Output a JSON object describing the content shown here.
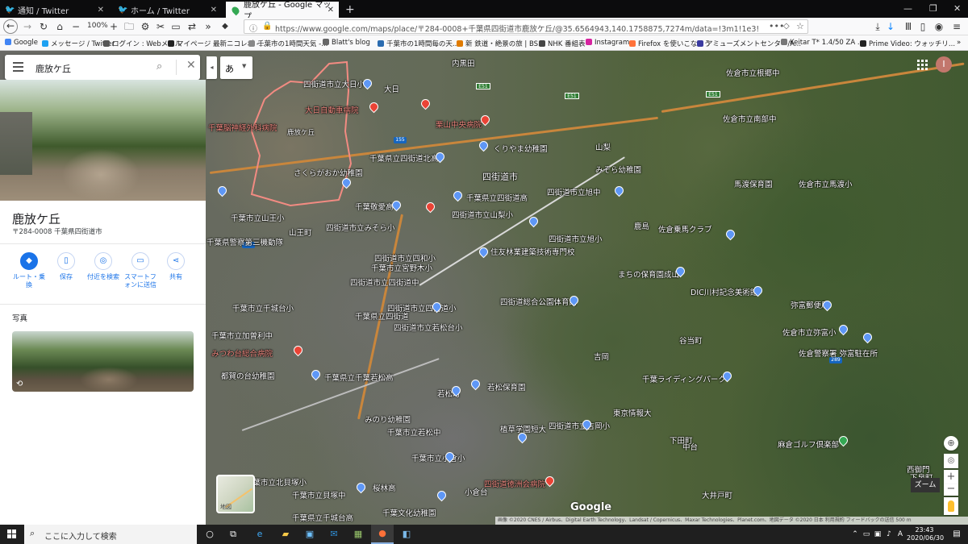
{
  "browser": {
    "tabs": [
      {
        "title": "通知 / Twitter",
        "icon": "twitter-icon"
      },
      {
        "title": "ホーム / Twitter",
        "icon": "twitter-icon"
      },
      {
        "title": "鹿放ケ丘 - Google マップ",
        "icon": "google-maps-icon",
        "active": true
      }
    ],
    "zoom": "100%",
    "url": "https://www.google.com/maps/place/〒284-0008+千葉県四街道市鹿放ケ丘/@35.6564943,140.1758875,7274m/data=!3m1!1e3!4m5!3m4!1s0x602285ccf8840e",
    "bookmarks": [
      "Google",
      "メッセージ / Twitter",
      "ログイン : Webメール",
      "マイページ 最新ニコレポ -...",
      "千葉市の1時間天気 -...",
      "Blatt's blog",
      "千葉市の1時間毎の天...",
      "新 鉄道・絶景の旅 | BS...",
      "NHK 番組表",
      "Instagram",
      "Firefox を使いこなそう",
      "アミューズメントセンター/A...",
      "Keitar T* 1.4/50 ZA ...",
      "Prime Video: ウォッチリ..."
    ]
  },
  "maps": {
    "search_value": "鹿放ケ丘",
    "ime_label": "あ",
    "place": {
      "title": "鹿放ケ丘",
      "address": "〒284-0008 千葉県四街道市"
    },
    "actions": [
      {
        "label": "ルート・乗換",
        "icon": "directions-icon"
      },
      {
        "label": "保存",
        "icon": "bookmark-icon"
      },
      {
        "label": "付近を検索",
        "icon": "nearby-icon"
      },
      {
        "label": "スマートフォンに送信",
        "icon": "send-to-phone-icon"
      },
      {
        "label": "共有",
        "icon": "share-icon"
      }
    ],
    "photos_heading": "写真",
    "avatar_letter": "I",
    "zoom_label": "ズーム",
    "layer_label": "地図",
    "google_logo": "Google",
    "attribution": "画像 ©2020 CNES / Airbus、Digital Earth Technology、Landsat / Copernicus、Maxar Technologies、Planet.com、地図データ ©2020    日本    利用規約    フィードバックの送信    500 m",
    "labels": [
      "内黒田",
      "四街道市立大日小",
      "大日",
      "大日自動車病院",
      "千葉脳神経外科病院",
      "鹿放ケ丘",
      "栗山中央病院",
      "くりやま幼稚園",
      "千葉県立四街道北高",
      "さくらがおか幼稚園",
      "大日家屋通り",
      "四街道市",
      "千葉県立四街道高",
      "千葉敬愛高",
      "四街道市立旭中",
      "四街道市立みそら小",
      "四街道市立中央小",
      "四街道市立四和小",
      "千葉市立山王小",
      "千葉県警察第三機動隊",
      "山王町",
      "四街道市立山梨小",
      "四街道市立旭小",
      "住友林業建築技術専門校",
      "千葉市立宮野木小",
      "四街道市立四和小",
      "四街道市立四街道中",
      "みそら幼稚園",
      "千葉県立四街道高",
      "まちの保育園成山",
      "佐倉乗馬クラブ",
      "DIC川村記念美術館",
      "四街道市立四街道小",
      "千葉市立千城台小",
      "千葉県立四街道",
      "四街道市立若松台小",
      "四街道総合公園体育館",
      "佐倉市立南部中",
      "佐倉市立根郷中",
      "馬渡保育園",
      "佐倉市立馬渡小",
      "弥富郵便局",
      "佐倉市立弥富小",
      "佐倉警察署 弥富駐在所",
      "千葉ライディングパーク",
      "東京情報大",
      "四街道市立吉岡小",
      "下田町",
      "麻倉ゴルフ倶楽部",
      "千葉市立加曽利中",
      "みつわ台総合病院",
      "都賀の台幼稚園",
      "千葉県立千葉若松高",
      "若松町",
      "若松保育園",
      "みのり幼稚園",
      "千葉市立若松中",
      "植草学園短大",
      "千葉市立小倉小",
      "千葉市立北貝塚小",
      "四街道徳洲会病院",
      "桜林高",
      "小倉台",
      "千葉市立貝塚中",
      "千葉文化幼稚園",
      "千葉県立千城台高",
      "下泉町",
      "大井戸町",
      "西御門",
      "宮田",
      "佐倉市立王子台小",
      "佐倉市立さくら台",
      "佐倉市立根郷小",
      "千葉市立若松小",
      "佐倉市立王子台",
      "佐倉市立和田小",
      "千葉市立都賀中",
      "千葉市立みつわ台",
      "吉岡",
      "谷当町",
      "中台",
      "鹿島",
      "山梨"
    ]
  },
  "taskbar": {
    "search_placeholder": "ここに入力して検索",
    "time": "23:43",
    "date": "2020/06/30"
  }
}
